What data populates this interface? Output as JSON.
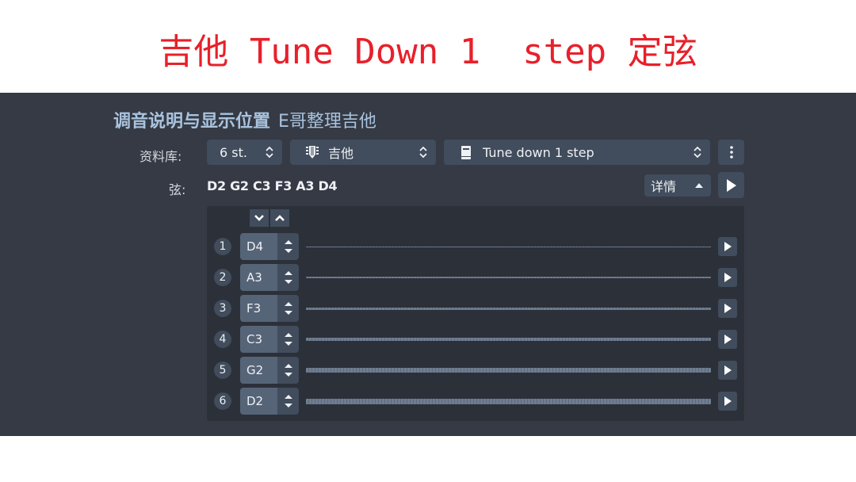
{
  "banner": {
    "title": "吉他 Tune Down 1  step 定弦",
    "color": "#e8202a"
  },
  "panel": {
    "heading": "调音说明与显示位置",
    "heading_sub": "E哥整理吉他",
    "library_label": "资料库:",
    "strings_count": {
      "value": "6 st.",
      "icon": "updown-chevrons-icon"
    },
    "instrument": {
      "value": "吉他",
      "icon": "guitar-headstock-icon"
    },
    "preset": {
      "value": "Tune down 1 step",
      "icon": "book-icon"
    },
    "more_icon": "vertical-ellipsis-icon",
    "tuning_label": "弦:",
    "tuning_value": "D2 G2 C3 F3 A3 D4",
    "details_label": "详情",
    "details_icon": "caret-up-icon",
    "play_all_icon": "play-icon",
    "shift_down_icon": "chevron-down-icon",
    "shift_up_icon": "chevron-up-icon",
    "strings": [
      {
        "number": "1",
        "note": "D4"
      },
      {
        "number": "2",
        "note": "A3"
      },
      {
        "number": "3",
        "note": "F3"
      },
      {
        "number": "4",
        "note": "C3"
      },
      {
        "number": "5",
        "note": "G2"
      },
      {
        "number": "6",
        "note": "D2"
      }
    ]
  },
  "colors": {
    "panel_bg": "#353a44",
    "control_bg": "#414c5c",
    "heading": "#a9c3de"
  }
}
